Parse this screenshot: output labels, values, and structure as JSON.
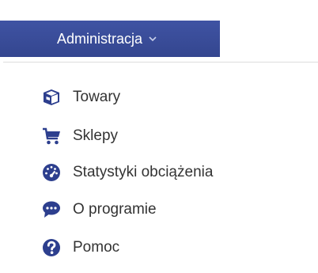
{
  "menu": {
    "label": "Administracja",
    "icon": "chevron-down-icon",
    "accent_color": "#34468f"
  },
  "dropdown": {
    "items": [
      {
        "label": "Towary",
        "icon": "box-icon"
      },
      {
        "label": "Sklepy",
        "icon": "shopping-cart-icon"
      },
      {
        "label": "Statystyki obciążenia",
        "icon": "speedometer-icon"
      },
      {
        "label": "O programie",
        "icon": "chat-bubble-icon"
      },
      {
        "label": "Pomoc",
        "icon": "question-circle-icon"
      }
    ],
    "icon_color": "#2d3f8e",
    "text_color": "#333333"
  }
}
